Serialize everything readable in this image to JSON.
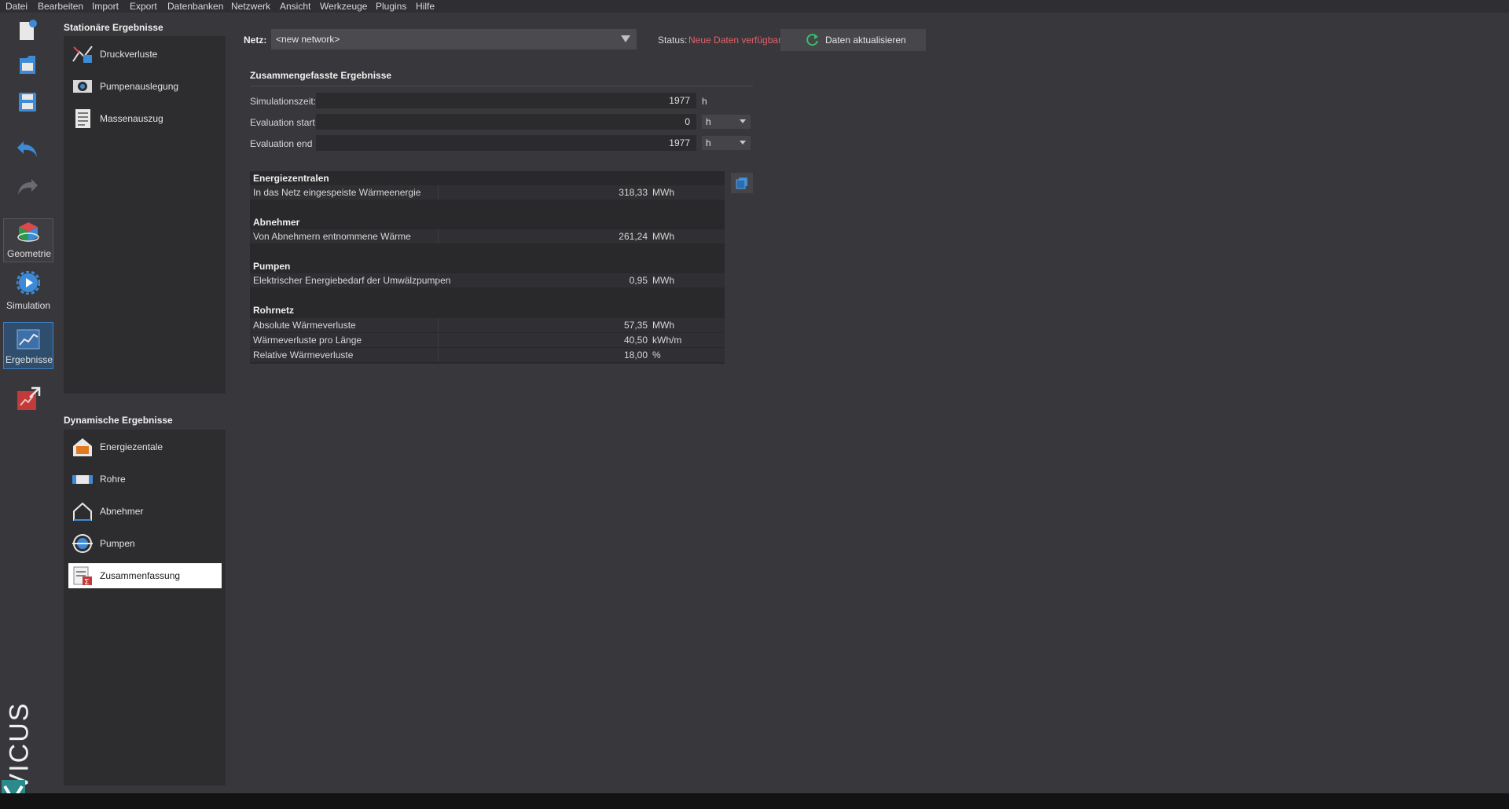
{
  "menu": [
    "Datei",
    "Bearbeiten",
    "Import",
    "Export",
    "Datenbanken",
    "Netzwerk",
    "Ansicht",
    "Werkzeuge",
    "Plugins",
    "Hilfe"
  ],
  "toolbar": {
    "geometry_label": "Geometrie",
    "simulation_label": "Simulation",
    "results_label": "Ergebnisse",
    "brand": "VICUS"
  },
  "stationary": {
    "title": "Stationäre Ergebnisse",
    "items": [
      "Druckverluste",
      "Pumpenauslegung",
      "Massenauszug"
    ]
  },
  "dynamic": {
    "title": "Dynamische Ergebnisse",
    "items": [
      "Energiezentale",
      "Rohre",
      "Abnehmer",
      "Pumpen",
      "Zusammenfassung"
    ],
    "selected": "Zusammenfassung"
  },
  "header": {
    "net_label": "Netz:",
    "net_value": "<new network>",
    "status_label": "Status:",
    "status_value": "Neue Daten verfügbar",
    "refresh_label": "Daten aktualisieren"
  },
  "summary": {
    "title": "Zusammengefasste Ergebnisse",
    "sim_time_label": "Simulationszeit:",
    "sim_time_value": "1977",
    "sim_time_unit": "h",
    "eval_start_label": "Evaluation start",
    "eval_start_value": "0",
    "eval_start_unit": "h",
    "eval_end_label": "Evaluation end",
    "eval_end_value": "1977",
    "eval_end_unit": "h"
  },
  "table": {
    "sections": [
      {
        "title": "Energiezentralen",
        "rows": [
          {
            "label": "In das Netz eingespeiste Wärmeenergie",
            "value": "318,33",
            "unit": "MWh"
          }
        ]
      },
      {
        "title": "Abnehmer",
        "rows": [
          {
            "label": "Von Abnehmern entnommene Wärme",
            "value": "261,24",
            "unit": "MWh"
          }
        ]
      },
      {
        "title": "Pumpen",
        "rows": [
          {
            "label": "Elektrischer Energiebedarf der Umwälzpumpen",
            "value": "0,95",
            "unit": "MWh"
          }
        ]
      },
      {
        "title": "Rohrnetz",
        "rows": [
          {
            "label": "Absolute Wärmeverluste",
            "value": "57,35",
            "unit": "MWh"
          },
          {
            "label": "Wärmeverluste pro Länge",
            "value": "40,50",
            "unit": "kWh/m"
          },
          {
            "label": "Relative Wärmeverluste",
            "value": "18,00",
            "unit": "%"
          }
        ]
      }
    ]
  },
  "colors": {
    "status": "#e0606a",
    "accent": "#3d7fc0",
    "refresh_icon": "#35c06a"
  }
}
